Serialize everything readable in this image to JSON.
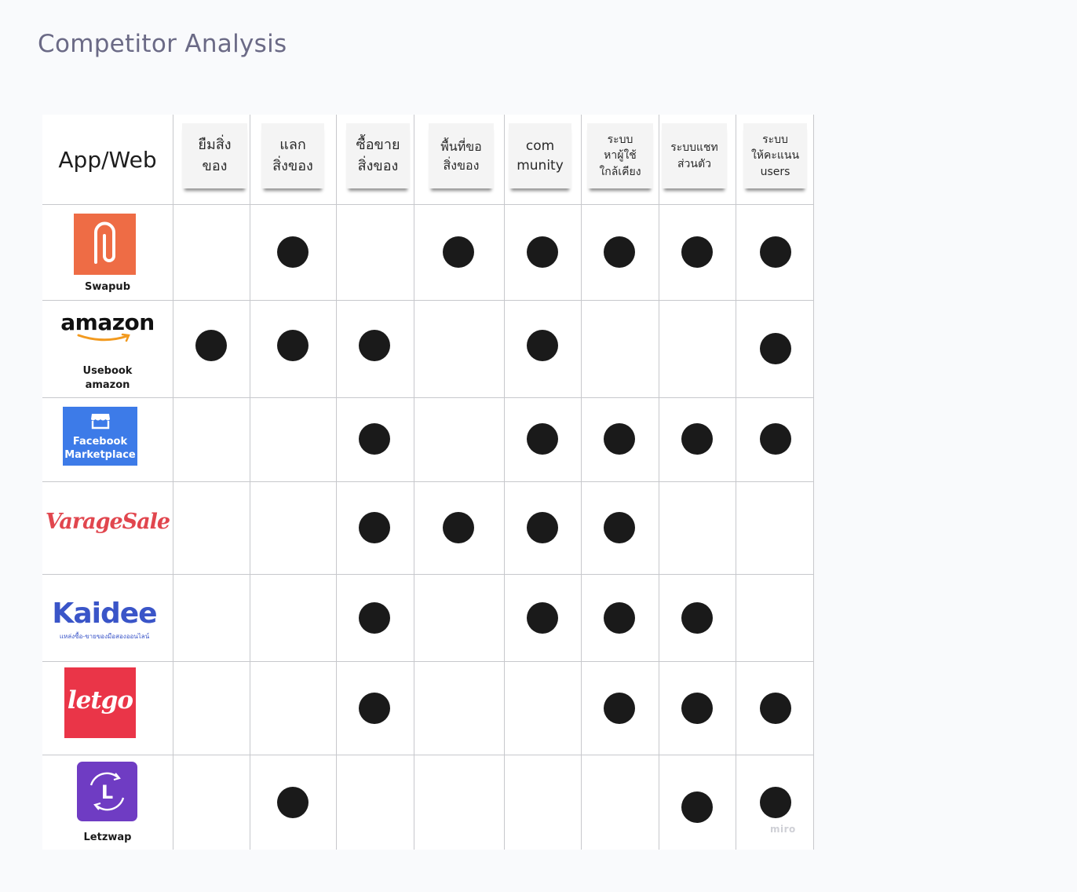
{
  "page": {
    "title": "Competitor Analysis"
  },
  "table": {
    "corner_label": "App/Web",
    "columns": [
      {
        "lines": [
          "ยืมสิ่ง",
          "ของ"
        ]
      },
      {
        "lines": [
          "แลก",
          "สิ่งของ"
        ]
      },
      {
        "lines": [
          "ซื้อขาย",
          "สิ่งของ"
        ]
      },
      {
        "lines": [
          "พื้นที่ขอ",
          "สิ่งของ"
        ]
      },
      {
        "lines": [
          "com",
          "munity"
        ]
      },
      {
        "lines": [
          "ระบบ",
          "หาผู้ใช้",
          "ใกล้เคียง"
        ]
      },
      {
        "lines": [
          "ระบบแชท",
          "ส่วนตัว"
        ]
      },
      {
        "lines": [
          "ระบบ",
          "ให้คะแนน",
          "users"
        ]
      }
    ],
    "rows": [
      {
        "app": "Swapub",
        "caption": [
          "Swapub"
        ],
        "features": [
          false,
          true,
          false,
          true,
          true,
          true,
          true,
          true
        ]
      },
      {
        "app": "Usebook amazon",
        "caption": [
          "Usebook",
          "amazon"
        ],
        "logo_text": "amazon",
        "features": [
          true,
          true,
          true,
          false,
          true,
          false,
          false,
          true
        ]
      },
      {
        "app": "Facebook Marketplace",
        "caption": [],
        "logo_text": [
          "Facebook",
          "Marketplace"
        ],
        "features": [
          false,
          false,
          true,
          false,
          true,
          true,
          true,
          true
        ]
      },
      {
        "app": "VarageSale",
        "caption": [],
        "logo_text": "VarageSale",
        "features": [
          false,
          false,
          true,
          true,
          true,
          true,
          false,
          false
        ]
      },
      {
        "app": "Kaidee",
        "caption": [],
        "logo_text": "Kaidee",
        "logo_subtext": "แหล่งซื้อ-ขายของมือสองออนไลน์",
        "features": [
          false,
          false,
          true,
          false,
          true,
          true,
          true,
          false
        ]
      },
      {
        "app": "letgo",
        "caption": [],
        "logo_text": "letgo",
        "features": [
          false,
          false,
          true,
          false,
          false,
          true,
          true,
          true
        ]
      },
      {
        "app": "Letzwap",
        "caption": [
          "Letzwap"
        ],
        "logo_text": "L",
        "features": [
          false,
          true,
          false,
          false,
          false,
          false,
          true,
          true
        ]
      }
    ]
  },
  "colors": {
    "swapub": "#ee6c45",
    "facebook": "#3d7be8",
    "varage": "#e1464e",
    "kaidee": "#3a55c8",
    "letgo": "#ea3548",
    "letzwap": "#6f3cc3",
    "amazon_smile": "#f29a1f",
    "dot": "#1a1a1a"
  },
  "watermark": "miro"
}
